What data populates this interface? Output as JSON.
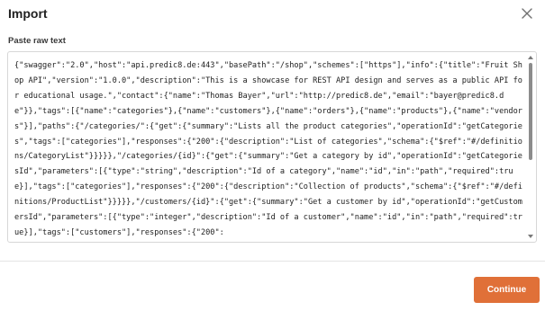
{
  "dialog": {
    "title": "Import",
    "field_label": "Paste raw text",
    "raw_text": "{\"swagger\":\"2.0\",\"host\":\"api.predic8.de:443\",\"basePath\":\"/shop\",\"schemes\":[\"https\"],\"info\":{\"title\":\"Fruit Shop API\",\"version\":\"1.0.0\",\"description\":\"This is a showcase for REST API design and serves as a public API for educational usage.\",\"contact\":{\"name\":\"Thomas Bayer\",\"url\":\"http://predic8.de\",\"email\":\"bayer@predic8.de\"}},\"tags\":[{\"name\":\"categories\"},{\"name\":\"customers\"},{\"name\":\"orders\"},{\"name\":\"products\"},{\"name\":\"vendors\"}],\"paths\":{\"/categories/\":{\"get\":{\"summary\":\"Lists all the product categories\",\"operationId\":\"getCategories\",\"tags\":[\"categories\"],\"responses\":{\"200\":{\"description\":\"List of categories\",\"schema\":{\"$ref\":\"#/definitions/CategoryList\"}}}}},\"/categories/{id}\":{\"get\":{\"summary\":\"Get a category by id\",\"operationId\":\"getCategoriesId\",\"parameters\":[{\"type\":\"string\",\"description\":\"Id of a category\",\"name\":\"id\",\"in\":\"path\",\"required\":true}],\"tags\":[\"categories\"],\"responses\":{\"200\":{\"description\":\"Collection of products\",\"schema\":{\"$ref\":\"#/definitions/ProductList\"}}}}},\"/customers/{id}\":{\"get\":{\"summary\":\"Get a customer by id\",\"operationId\":\"getCustomersId\",\"parameters\":[{\"type\":\"integer\",\"description\":\"Id of a customer\",\"name\":\"id\",\"in\":\"path\",\"required\":true}],\"tags\":[\"customers\"],\"responses\":{\"200\":"
  },
  "buttons": {
    "continue_label": "Continue"
  },
  "icons": {
    "close": "close-icon"
  },
  "colors": {
    "accent": "#e07038",
    "border": "#d7d7d7",
    "divider": "#e4e4e4"
  }
}
